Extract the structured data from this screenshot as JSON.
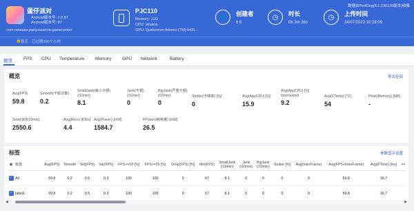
{
  "header": {
    "app": {
      "name": "蛋仔派对",
      "android_version": "Android版本号: 1.0.87",
      "android_build": "Android版本号: 87",
      "package": "com.netease.party.nearme.gamecenter"
    },
    "extra_note": "暂无 · 已过期300个小时",
    "device": {
      "name": "PJC110",
      "memory": "Memory: 11G",
      "cpu": "CPU: lahaina",
      "gpu": "GPU: Qualcomm Adreno (TM) 642L"
    },
    "creator": {
      "label": "创建者",
      "value": "6 6"
    },
    "duration": {
      "label": "时长",
      "value": "0h 2m 28s"
    },
    "upload_time": {
      "label": "上传时间",
      "value": "24/07/2023 10:28:09"
    },
    "version": "数据由PerfDog(8.1.230120版本)收集"
  },
  "tabs": [
    "概览",
    "FPS",
    "CPU",
    "Temperature",
    "Memory",
    "GPU",
    "Network",
    "Battery"
  ],
  "overview": {
    "title": "概览",
    "link": "导出全部",
    "row1": [
      {
        "label": "Avg(FPS)",
        "value": "59.8"
      },
      {
        "label": "Smooth(卡顿次数)\n",
        "value": "0.2"
      },
      {
        "label": "SmallJank(每小卡顿)\n(/10min)",
        "value": "8.1"
      },
      {
        "label": "Jank(卡顿)\n(/10min)",
        "value": "0"
      },
      {
        "label": "BigJank(严重卡顿)\n(/10min)",
        "value": "0"
      },
      {
        "label": "Stutter(卡顿率) [%]",
        "value": "0"
      },
      {
        "label": "Avg(AppCPU) [%]",
        "value": "15.9"
      },
      {
        "label": "Avg(AppCPU) [%]\nNormalized",
        "value": "9.2"
      },
      {
        "label": "Avg(CTemp) [°C]",
        "value": "54"
      },
      {
        "label": "Peak(Memory) [MB]",
        "value": "-"
      }
    ],
    "row2": [
      {
        "label": "Send [KB/10min]",
        "value": "2550.6"
      },
      {
        "label": "Avg(Recv) [KB/s]",
        "value": "4.4"
      },
      {
        "label": "Avg(Power) [mW]",
        "value": "1584.7"
      },
      {
        "label": "FPower(耗电量) [mW]",
        "value": "26.5"
      }
    ]
  },
  "labels": {
    "title": "标签",
    "link": "参数显示设置",
    "columns": [
      "",
      "标签",
      "Avg(FPS)",
      "Smooth",
      "Std(FPS)",
      "Var(FPS)",
      "FPS>=18 [%]",
      "FPS>=25 [%]",
      "Drop(FPS) [%]",
      "Min(FPS)",
      "SmallJank\n(/10min)",
      "Jank\n(/10min)",
      "BigJank\n(/10min)",
      "Stutter [%]",
      "Avg(InterFrame)",
      "Avg(FPS+InterFrame)",
      "Avg(FTime) [ms]",
      ">="
    ],
    "rows": [
      [
        "59.8",
        "0.2",
        "0.5",
        "0.3",
        "100",
        "100",
        "0",
        "57",
        "8.1",
        "0",
        "0",
        "0",
        "0",
        "59.8",
        "16.7",
        ""
      ],
      [
        "59.8",
        "0.2",
        "0.5",
        "0.3",
        "100",
        "100",
        "0",
        "57",
        "8.1",
        "0",
        "0",
        "0",
        "0",
        "59.8",
        "16.7",
        ""
      ]
    ],
    "row_names": [
      "All",
      "label1"
    ]
  }
}
